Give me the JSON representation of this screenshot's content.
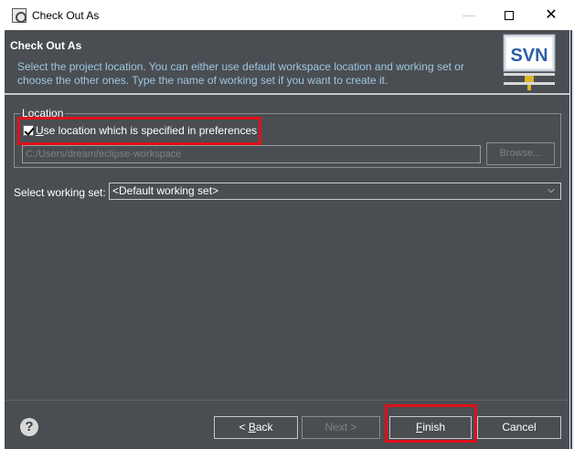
{
  "window": {
    "title": "Check Out As",
    "minimize_glyph": "—",
    "close_glyph": "✕"
  },
  "header": {
    "title": "Check Out As",
    "description": "Select the project location. You can either use default workspace location and working set or choose the other ones. Type the name of working set if you want to create it.",
    "logo_text": "SVN"
  },
  "location_group": {
    "legend": "Location",
    "use_preferences_checkbox": {
      "label_mnemonic": "U",
      "label_rest": "se location which is specified in preferences",
      "checked": true
    },
    "path_value": "C:/Users/dream/eclipse-workspace",
    "browse_label": "Browse..."
  },
  "working_set": {
    "label": "Select working set:",
    "selected": "<Default working set>"
  },
  "buttons": {
    "help_glyph": "?",
    "back_prefix": "< ",
    "back_mnemonic": "B",
    "back_rest": "ack",
    "next": "Next >",
    "finish_mnemonic": "F",
    "finish_rest": "inish",
    "cancel": "Cancel"
  },
  "colors": {
    "dialog_background": "#4a4e52",
    "highlight": "#e0101a",
    "description_text": "#9fc6e0"
  }
}
